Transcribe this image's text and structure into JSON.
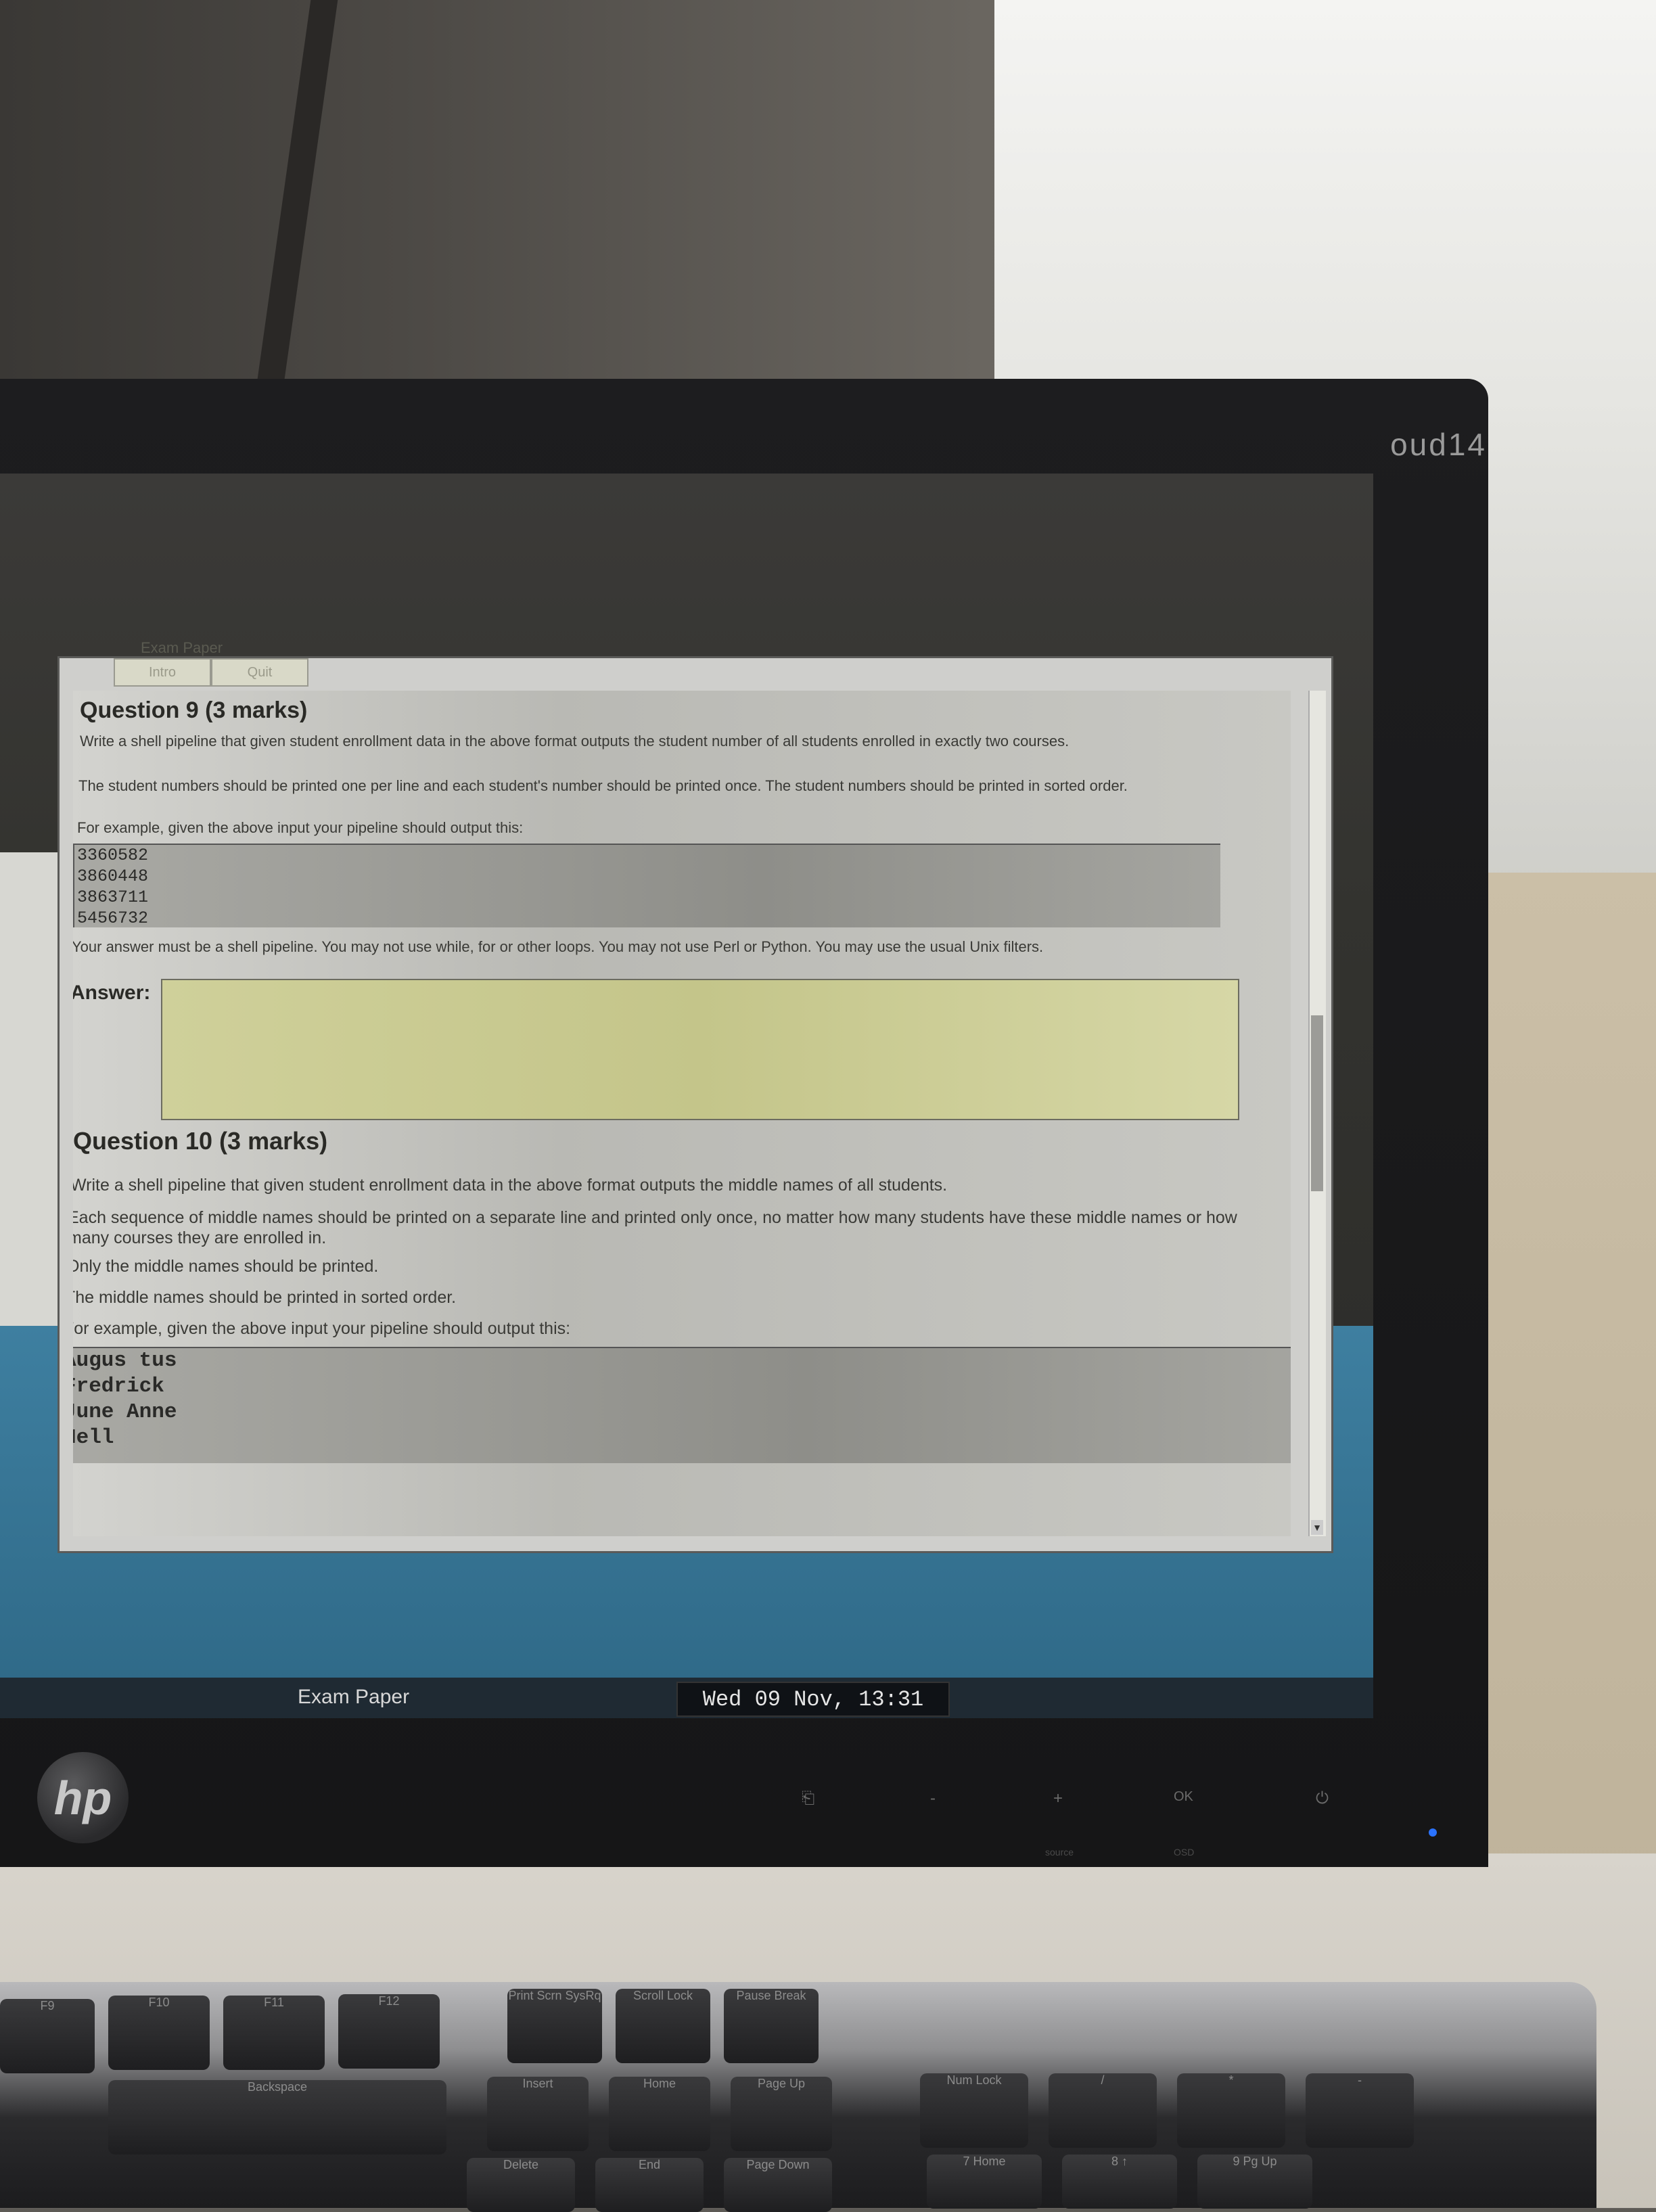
{
  "monitor": {
    "brand": "oud14"
  },
  "window": {
    "title": "Exam Paper",
    "tabs": [
      "Intro",
      "Quit"
    ]
  },
  "q9": {
    "title": "Question 9 (3 marks)",
    "p1": "Write a shell pipeline that given student enrollment data in the above format outputs the student number of all students enrolled in exactly two courses.",
    "p2": "The student numbers should be printed one per line and each student's number should be printed once. The student numbers should be printed in sorted order.",
    "p3": "For example, given the above input your pipeline should output this:",
    "output": [
      "3360582",
      "3860448",
      "3863711",
      "5456732"
    ],
    "note": "Your answer must be a shell pipeline. You may not use while, for or other loops. You may not use Perl or Python. You may use the usual Unix filters.",
    "answer_label": "Answer:"
  },
  "q10": {
    "title": "Question 10 (3 marks)",
    "p1": "Write a shell pipeline that given student enrollment data in the above format outputs the middle names of all students.",
    "p2": "Each sequence of middle names should be printed on a separate line and printed only once, no matter how many students have these middle names or how many courses they are enrolled in.",
    "p3": "Only the middle names should be printed.",
    "p4": "The middle names should be printed in sorted order.",
    "p5": "For example, given the above input your pipeline should output this:",
    "output": [
      "Augus tus",
      "Fredrick",
      "June Anne",
      "Nell"
    ]
  },
  "taskbar": {
    "app_label": "Exam Paper",
    "clock": "Wed 09 Nov, 13:31"
  },
  "bezel": {
    "logo_text": "hp",
    "buttons": [
      "-",
      "+",
      "OK"
    ],
    "button_captions": [
      "source",
      "OSD"
    ]
  },
  "keyboard": {
    "keys": [
      "F9",
      "F10",
      "F11",
      "F12",
      "Print Scrn SysRq",
      "Scroll Lock",
      "Pause Break",
      "Backspace",
      "Insert",
      "Home",
      "Page Up",
      "Num Lock",
      "/",
      "*",
      "-",
      "Delete",
      "End",
      "Page Down",
      "7 Home",
      "8 ↑",
      "9 Pg Up"
    ]
  },
  "colors": {
    "answer_field": "#c4c58a",
    "taskbar": "#1f2a33",
    "desktop": "#2e6886",
    "power_led": "#2b73ff"
  }
}
